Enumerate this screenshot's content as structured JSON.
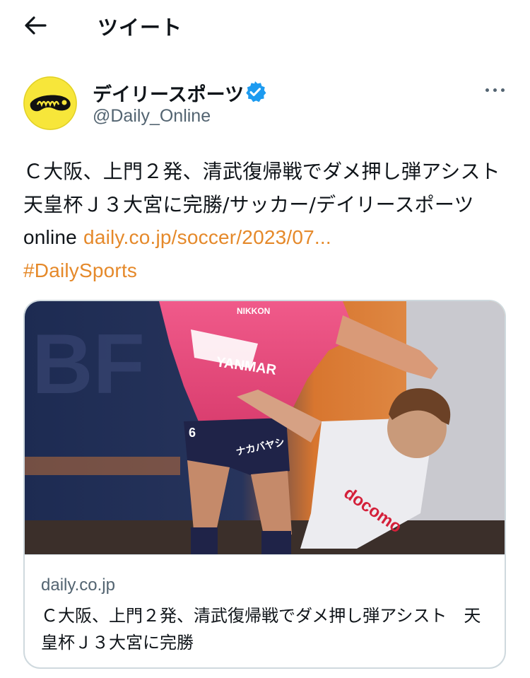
{
  "header": {
    "back_icon": "arrow-left-icon",
    "title": "ツイート"
  },
  "author": {
    "name": "デイリースポーツ",
    "handle": "@Daily_Online",
    "avatar_icon": "daily-sports-logo",
    "verified_icon": "verified-badge-icon",
    "more_icon": "more-horizontal-icon",
    "colors": {
      "verified": "#1d9bf0",
      "avatar_bg": "#f7e63a"
    }
  },
  "tweet": {
    "text": "Ｃ大阪、上門２発、清武復帰戦でダメ押し弾アシスト　天皇杯Ｊ３大宮に完勝/サッカー/デイリースポーツ",
    "text_latin": "online",
    "link": "daily.co.jp/soccer/2023/07...",
    "hashtag": "#DailySports",
    "link_color": "#e5892a"
  },
  "card": {
    "image_description_icon": "soccer-match-photo",
    "domain": "daily.co.jp",
    "title": "Ｃ大阪、上門２発、清武復帰戦でダメ押し弾アシスト　天皇杯Ｊ３大宮に完勝",
    "photo_texts": {
      "sponsor_top": "NIKKON",
      "shirt_main": "YANMAR",
      "shorts": "ナカバヤシ",
      "number": "6",
      "opponent_sponsor": "docomo",
      "wall_text": "BF"
    }
  }
}
